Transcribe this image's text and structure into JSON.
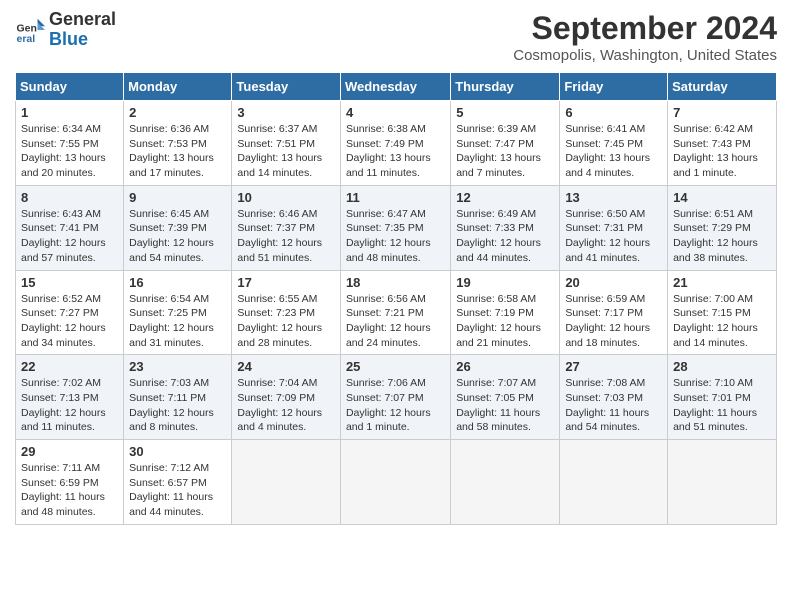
{
  "logo": {
    "line1": "General",
    "line2": "Blue"
  },
  "title": "September 2024",
  "subtitle": "Cosmopolis, Washington, United States",
  "days_header": [
    "Sunday",
    "Monday",
    "Tuesday",
    "Wednesday",
    "Thursday",
    "Friday",
    "Saturday"
  ],
  "weeks": [
    [
      {
        "day": "1",
        "sunrise": "6:34 AM",
        "sunset": "7:55 PM",
        "daylight": "13 hours and 20 minutes."
      },
      {
        "day": "2",
        "sunrise": "6:36 AM",
        "sunset": "7:53 PM",
        "daylight": "13 hours and 17 minutes."
      },
      {
        "day": "3",
        "sunrise": "6:37 AM",
        "sunset": "7:51 PM",
        "daylight": "13 hours and 14 minutes."
      },
      {
        "day": "4",
        "sunrise": "6:38 AM",
        "sunset": "7:49 PM",
        "daylight": "13 hours and 11 minutes."
      },
      {
        "day": "5",
        "sunrise": "6:39 AM",
        "sunset": "7:47 PM",
        "daylight": "13 hours and 7 minutes."
      },
      {
        "day": "6",
        "sunrise": "6:41 AM",
        "sunset": "7:45 PM",
        "daylight": "13 hours and 4 minutes."
      },
      {
        "day": "7",
        "sunrise": "6:42 AM",
        "sunset": "7:43 PM",
        "daylight": "13 hours and 1 minute."
      }
    ],
    [
      {
        "day": "8",
        "sunrise": "6:43 AM",
        "sunset": "7:41 PM",
        "daylight": "12 hours and 57 minutes."
      },
      {
        "day": "9",
        "sunrise": "6:45 AM",
        "sunset": "7:39 PM",
        "daylight": "12 hours and 54 minutes."
      },
      {
        "day": "10",
        "sunrise": "6:46 AM",
        "sunset": "7:37 PM",
        "daylight": "12 hours and 51 minutes."
      },
      {
        "day": "11",
        "sunrise": "6:47 AM",
        "sunset": "7:35 PM",
        "daylight": "12 hours and 48 minutes."
      },
      {
        "day": "12",
        "sunrise": "6:49 AM",
        "sunset": "7:33 PM",
        "daylight": "12 hours and 44 minutes."
      },
      {
        "day": "13",
        "sunrise": "6:50 AM",
        "sunset": "7:31 PM",
        "daylight": "12 hours and 41 minutes."
      },
      {
        "day": "14",
        "sunrise": "6:51 AM",
        "sunset": "7:29 PM",
        "daylight": "12 hours and 38 minutes."
      }
    ],
    [
      {
        "day": "15",
        "sunrise": "6:52 AM",
        "sunset": "7:27 PM",
        "daylight": "12 hours and 34 minutes."
      },
      {
        "day": "16",
        "sunrise": "6:54 AM",
        "sunset": "7:25 PM",
        "daylight": "12 hours and 31 minutes."
      },
      {
        "day": "17",
        "sunrise": "6:55 AM",
        "sunset": "7:23 PM",
        "daylight": "12 hours and 28 minutes."
      },
      {
        "day": "18",
        "sunrise": "6:56 AM",
        "sunset": "7:21 PM",
        "daylight": "12 hours and 24 minutes."
      },
      {
        "day": "19",
        "sunrise": "6:58 AM",
        "sunset": "7:19 PM",
        "daylight": "12 hours and 21 minutes."
      },
      {
        "day": "20",
        "sunrise": "6:59 AM",
        "sunset": "7:17 PM",
        "daylight": "12 hours and 18 minutes."
      },
      {
        "day": "21",
        "sunrise": "7:00 AM",
        "sunset": "7:15 PM",
        "daylight": "12 hours and 14 minutes."
      }
    ],
    [
      {
        "day": "22",
        "sunrise": "7:02 AM",
        "sunset": "7:13 PM",
        "daylight": "12 hours and 11 minutes."
      },
      {
        "day": "23",
        "sunrise": "7:03 AM",
        "sunset": "7:11 PM",
        "daylight": "12 hours and 8 minutes."
      },
      {
        "day": "24",
        "sunrise": "7:04 AM",
        "sunset": "7:09 PM",
        "daylight": "12 hours and 4 minutes."
      },
      {
        "day": "25",
        "sunrise": "7:06 AM",
        "sunset": "7:07 PM",
        "daylight": "12 hours and 1 minute."
      },
      {
        "day": "26",
        "sunrise": "7:07 AM",
        "sunset": "7:05 PM",
        "daylight": "11 hours and 58 minutes."
      },
      {
        "day": "27",
        "sunrise": "7:08 AM",
        "sunset": "7:03 PM",
        "daylight": "11 hours and 54 minutes."
      },
      {
        "day": "28",
        "sunrise": "7:10 AM",
        "sunset": "7:01 PM",
        "daylight": "11 hours and 51 minutes."
      }
    ],
    [
      {
        "day": "29",
        "sunrise": "7:11 AM",
        "sunset": "6:59 PM",
        "daylight": "11 hours and 48 minutes."
      },
      {
        "day": "30",
        "sunrise": "7:12 AM",
        "sunset": "6:57 PM",
        "daylight": "11 hours and 44 minutes."
      },
      null,
      null,
      null,
      null,
      null
    ]
  ]
}
